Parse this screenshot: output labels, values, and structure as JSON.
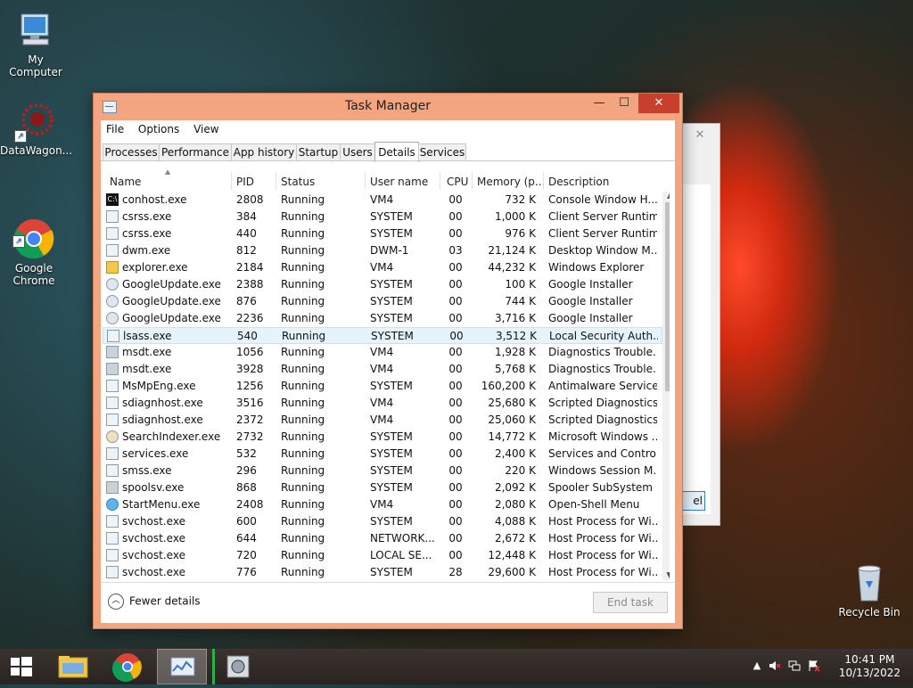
{
  "desktop": {
    "icons": [
      {
        "label": "My Computer"
      },
      {
        "label": "DataWagon..."
      },
      {
        "label": "Google\nChrome"
      },
      {
        "label": "Recycle Bin"
      }
    ]
  },
  "window": {
    "title": "Task Manager",
    "controls": {
      "minimize": "—",
      "maximize": "☐",
      "close": "✕"
    },
    "menu": [
      "File",
      "Options",
      "View"
    ],
    "tabs": [
      {
        "label": "Processes"
      },
      {
        "label": "Performance"
      },
      {
        "label": "App history"
      },
      {
        "label": "Startup"
      },
      {
        "label": "Users"
      },
      {
        "label": "Details",
        "active": true
      },
      {
        "label": "Services"
      }
    ],
    "columns": {
      "name": "Name",
      "pid": "PID",
      "status": "Status",
      "user": "User name",
      "cpu": "CPU",
      "memory": "Memory (p...",
      "description": "Description"
    },
    "rows": [
      {
        "name": "conhost.exe",
        "pid": "2808",
        "status": "Running",
        "user": "VM4",
        "cpu": "00",
        "memory": "732 K",
        "description": "Console Window H...",
        "icon": "console-icon"
      },
      {
        "name": "csrss.exe",
        "pid": "384",
        "status": "Running",
        "user": "SYSTEM",
        "cpu": "00",
        "memory": "1,000 K",
        "description": "Client Server Runtim...",
        "icon": "app-icon"
      },
      {
        "name": "csrss.exe",
        "pid": "440",
        "status": "Running",
        "user": "SYSTEM",
        "cpu": "00",
        "memory": "976 K",
        "description": "Client Server Runtim...",
        "icon": "app-icon"
      },
      {
        "name": "dwm.exe",
        "pid": "812",
        "status": "Running",
        "user": "DWM-1",
        "cpu": "03",
        "memory": "21,124 K",
        "description": "Desktop Window M...",
        "icon": "app-icon"
      },
      {
        "name": "explorer.exe",
        "pid": "2184",
        "status": "Running",
        "user": "VM4",
        "cpu": "00",
        "memory": "44,232 K",
        "description": "Windows Explorer",
        "icon": "folder-icon"
      },
      {
        "name": "GoogleUpdate.exe",
        "pid": "2388",
        "status": "Running",
        "user": "SYSTEM",
        "cpu": "00",
        "memory": "100 K",
        "description": "Google Installer",
        "icon": "google-update-icon"
      },
      {
        "name": "GoogleUpdate.exe",
        "pid": "876",
        "status": "Running",
        "user": "SYSTEM",
        "cpu": "00",
        "memory": "744 K",
        "description": "Google Installer",
        "icon": "google-update-icon"
      },
      {
        "name": "GoogleUpdate.exe",
        "pid": "2236",
        "status": "Running",
        "user": "SYSTEM",
        "cpu": "00",
        "memory": "3,716 K",
        "description": "Google Installer",
        "icon": "google-update-icon"
      },
      {
        "name": "lsass.exe",
        "pid": "540",
        "status": "Running",
        "user": "SYSTEM",
        "cpu": "00",
        "memory": "3,512 K",
        "description": "Local Security Auth...",
        "icon": "app-icon",
        "selected": true
      },
      {
        "name": "msdt.exe",
        "pid": "1056",
        "status": "Running",
        "user": "VM4",
        "cpu": "00",
        "memory": "1,928 K",
        "description": "Diagnostics Trouble...",
        "icon": "diagnostics-icon"
      },
      {
        "name": "msdt.exe",
        "pid": "3928",
        "status": "Running",
        "user": "VM4",
        "cpu": "00",
        "memory": "5,768 K",
        "description": "Diagnostics Trouble...",
        "icon": "diagnostics-icon"
      },
      {
        "name": "MsMpEng.exe",
        "pid": "1256",
        "status": "Running",
        "user": "SYSTEM",
        "cpu": "00",
        "memory": "160,200 K",
        "description": "Antimalware Service...",
        "icon": "app-icon"
      },
      {
        "name": "sdiagnhost.exe",
        "pid": "3516",
        "status": "Running",
        "user": "VM4",
        "cpu": "00",
        "memory": "25,680 K",
        "description": "Scripted Diagnostics...",
        "icon": "app-icon"
      },
      {
        "name": "sdiagnhost.exe",
        "pid": "2372",
        "status": "Running",
        "user": "VM4",
        "cpu": "00",
        "memory": "25,060 K",
        "description": "Scripted Diagnostics...",
        "icon": "app-icon"
      },
      {
        "name": "SearchIndexer.exe",
        "pid": "2732",
        "status": "Running",
        "user": "SYSTEM",
        "cpu": "00",
        "memory": "14,772 K",
        "description": "Microsoft Windows ...",
        "icon": "search-indexer-icon"
      },
      {
        "name": "services.exe",
        "pid": "532",
        "status": "Running",
        "user": "SYSTEM",
        "cpu": "00",
        "memory": "2,400 K",
        "description": "Services and Control...",
        "icon": "app-icon"
      },
      {
        "name": "smss.exe",
        "pid": "296",
        "status": "Running",
        "user": "SYSTEM",
        "cpu": "00",
        "memory": "220 K",
        "description": "Windows Session M...",
        "icon": "app-icon"
      },
      {
        "name": "spoolsv.exe",
        "pid": "868",
        "status": "Running",
        "user": "SYSTEM",
        "cpu": "00",
        "memory": "2,092 K",
        "description": "Spooler SubSystem ...",
        "icon": "printer-icon"
      },
      {
        "name": "StartMenu.exe",
        "pid": "2408",
        "status": "Running",
        "user": "VM4",
        "cpu": "00",
        "memory": "2,080 K",
        "description": "Open-Shell Menu",
        "icon": "start-menu-icon"
      },
      {
        "name": "svchost.exe",
        "pid": "600",
        "status": "Running",
        "user": "SYSTEM",
        "cpu": "00",
        "memory": "4,088 K",
        "description": "Host Process for Wi...",
        "icon": "app-icon"
      },
      {
        "name": "svchost.exe",
        "pid": "644",
        "status": "Running",
        "user": "NETWORK...",
        "cpu": "00",
        "memory": "2,672 K",
        "description": "Host Process for Wi...",
        "icon": "app-icon"
      },
      {
        "name": "svchost.exe",
        "pid": "720",
        "status": "Running",
        "user": "LOCAL SE...",
        "cpu": "00",
        "memory": "12,448 K",
        "description": "Host Process for Wi...",
        "icon": "app-icon"
      },
      {
        "name": "svchost.exe",
        "pid": "776",
        "status": "Running",
        "user": "SYSTEM",
        "cpu": "28",
        "memory": "29,600 K",
        "description": "Host Process for Wi...",
        "icon": "app-icon"
      }
    ],
    "footer": {
      "fewer_details": "Fewer details",
      "end_task": "End task"
    }
  },
  "background_window": {
    "button_fragment": "el",
    "close": "✕"
  },
  "taskbar": {
    "clock_time": "10:41 PM",
    "clock_date": "10/13/2022",
    "tray_arrow": "▲"
  },
  "colors": {
    "window_frame": "#f3a580",
    "close_button": "#c7402e",
    "selection": "#e5f3fb"
  }
}
